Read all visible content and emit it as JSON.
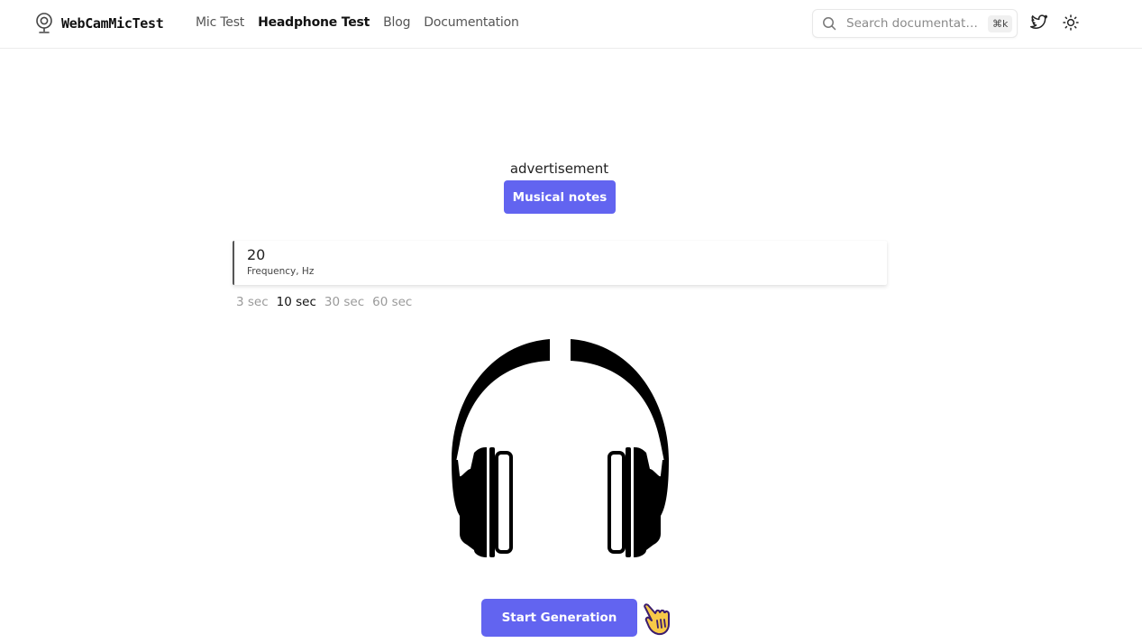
{
  "header": {
    "logo_text": "WebCamMicTest",
    "logo_icon": "webcam-icon",
    "nav": [
      {
        "label": "Mic Test",
        "active": false
      },
      {
        "label": "Headphone Test",
        "active": true
      },
      {
        "label": "Blog",
        "active": false
      },
      {
        "label": "Documentation",
        "active": false
      }
    ],
    "search": {
      "placeholder": "Search documentati…",
      "shortcut": "⌘k",
      "icon": "search-icon"
    },
    "twitter_icon": "twitter-icon",
    "theme_icon": "sun-icon"
  },
  "main": {
    "ad_label": "advertisement",
    "musical_notes_label": "Musical notes",
    "frequency": {
      "value": "20",
      "label": "Frequency, Hz"
    },
    "durations": [
      {
        "label": "3 sec",
        "active": false
      },
      {
        "label": "10 sec",
        "active": true
      },
      {
        "label": "30 sec",
        "active": false
      },
      {
        "label": "60 sec",
        "active": false
      }
    ],
    "illustration": "headphones-icon",
    "start_label": "Start Generation",
    "pointer_icon": "pointing-hand-icon",
    "accent_color": "#6264f0"
  }
}
